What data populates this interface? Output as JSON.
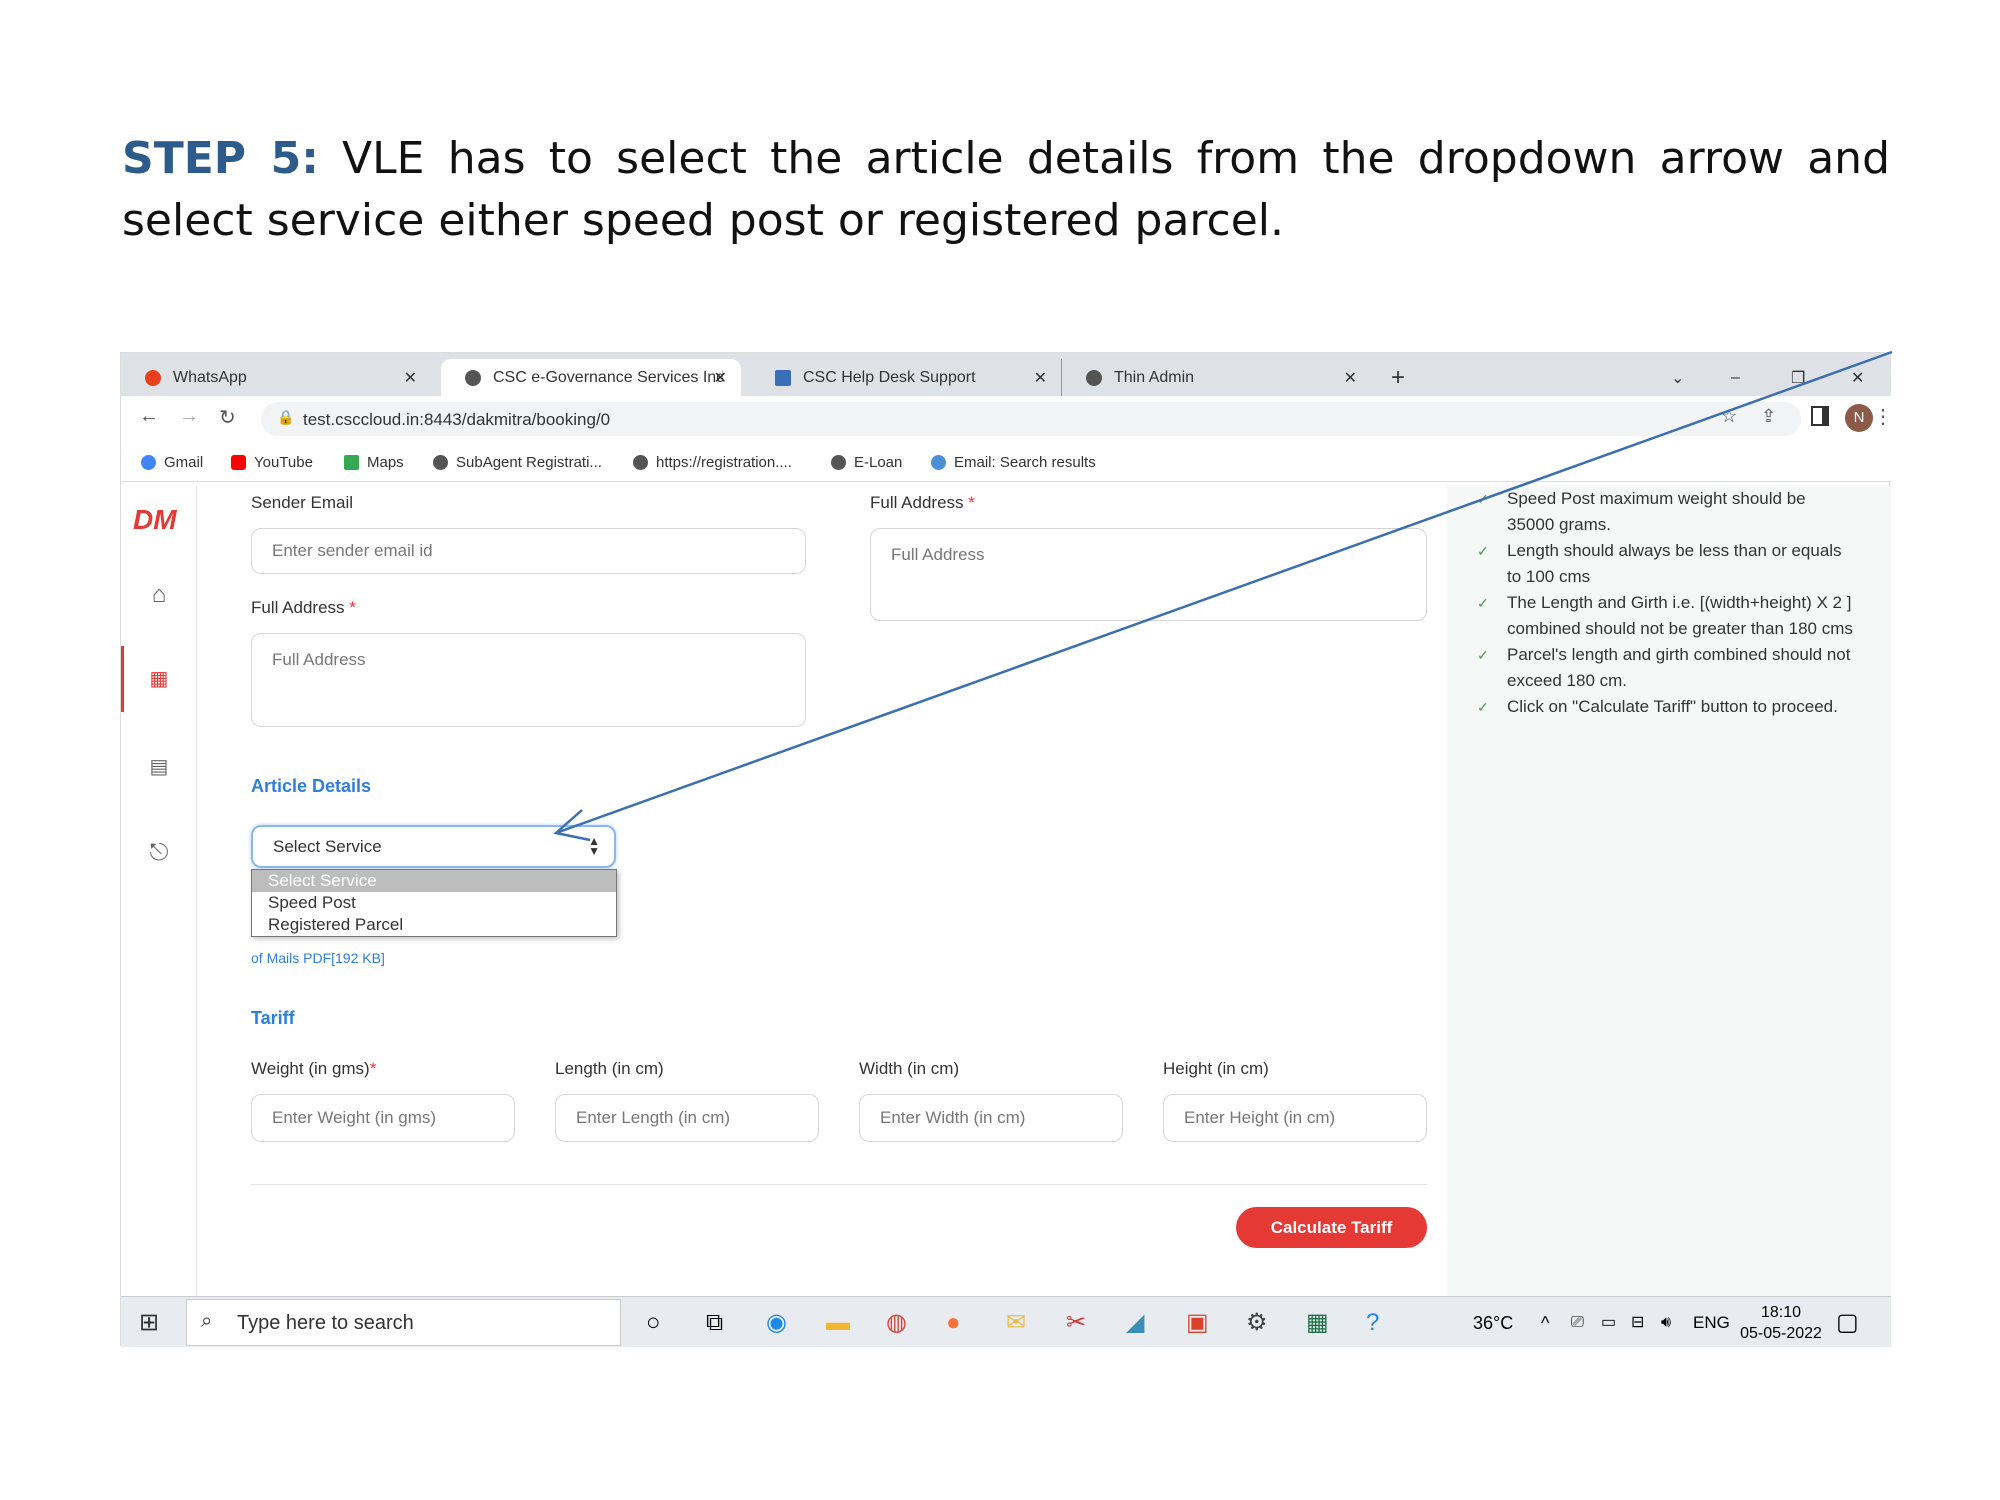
{
  "heading": {
    "step": "STEP 5:",
    "text": " VLE has to select the article details from the dropdown arrow and select service either speed post or registered parcel."
  },
  "browser": {
    "tabs": [
      {
        "label": "WhatsApp",
        "color": "#e8401c"
      },
      {
        "label": "CSC e-Governance Services India",
        "color": "#555"
      },
      {
        "label": "CSC Help Desk Support",
        "color": "#3a6fb5"
      },
      {
        "label": "Thin Admin",
        "color": "#555"
      }
    ],
    "new_tab": "+",
    "url": "test.csccloud.in:8443/dakmitra/booking/0",
    "profile": "N",
    "bookmarks": [
      {
        "label": "Gmail",
        "color": "#4285f4"
      },
      {
        "label": "YouTube",
        "color": "#ff0000"
      },
      {
        "label": "Maps",
        "color": "#34a853"
      },
      {
        "label": "SubAgent Registrati...",
        "color": "#555"
      },
      {
        "label": "https://registration....",
        "color": "#555"
      },
      {
        "label": "E-Loan",
        "color": "#555"
      },
      {
        "label": "Email: Search results",
        "color": "#4a90d9"
      }
    ]
  },
  "app": {
    "logo": "DM",
    "sender_email": {
      "label": "Sender Email",
      "placeholder": "Enter sender email id"
    },
    "full_address_left": {
      "label": "Full Address",
      "required": "*",
      "placeholder": "Full Address"
    },
    "full_address_right": {
      "label": "Full Address",
      "required": "*",
      "placeholder": "Full Address"
    },
    "article_details": "Article Details",
    "service_select": {
      "value": "Select Service",
      "options": [
        "Select Service",
        "Speed Post",
        "Registered Parcel"
      ]
    },
    "pdf_link": "of Mails PDF[192 KB]",
    "tariff": "Tariff",
    "fields": [
      {
        "label": "Weight (in gms)",
        "required": "*",
        "placeholder": "Enter Weight (in gms)"
      },
      {
        "label": "Length (in cm)",
        "placeholder": "Enter Length (in cm)"
      },
      {
        "label": "Width (in cm)",
        "placeholder": "Enter Width (in cm)"
      },
      {
        "label": "Height (in cm)",
        "placeholder": "Enter Height (in cm)"
      }
    ],
    "calculate_button": "Calculate Tariff",
    "notes": [
      "Speed Post maximum weight should be 35000 grams.",
      "Length should always be less than or equals to 100 cms",
      "The Length and Girth i.e. [(width+height) X 2 ] combined should not be greater than 180 cms",
      "Parcel's length and girth combined should not exceed 180 cm.",
      "Click on \"Calculate Tariff\" button to proceed."
    ],
    "accent": "#e53935",
    "link_color": "#2f7fd8"
  },
  "taskbar": {
    "search_placeholder": "Type here to search",
    "temperature": "36°C",
    "language": "ENG",
    "time": "18:10",
    "date": "05-05-2022"
  }
}
